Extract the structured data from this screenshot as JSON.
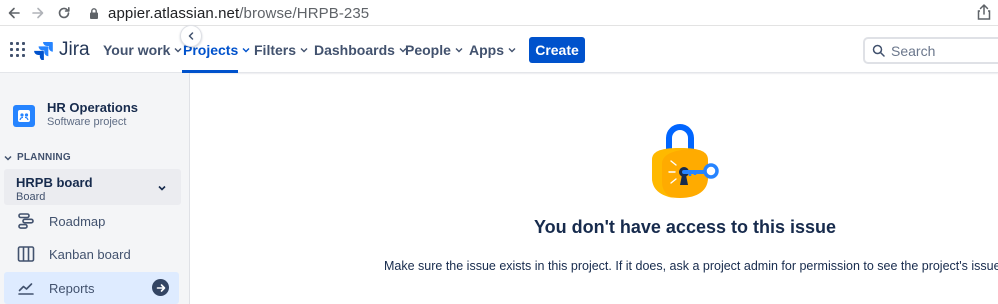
{
  "browser": {
    "url_host": "appier.atlassian.net",
    "url_path": "/browse/HRPB-235"
  },
  "topnav": {
    "logo_text": "Jira",
    "items": [
      {
        "label": "Your work"
      },
      {
        "label": "Projects"
      },
      {
        "label": "Filters"
      },
      {
        "label": "Dashboards"
      },
      {
        "label": "People"
      },
      {
        "label": "Apps"
      }
    ],
    "active_item": "Projects",
    "create_label": "Create",
    "search_placeholder": "Search"
  },
  "sidebar": {
    "project_name": "HR Operations",
    "project_type": "Software project",
    "section_label": "PLANNING",
    "board": {
      "name": "HRPB board",
      "type": "Board"
    },
    "items": [
      {
        "label": "Roadmap",
        "icon": "roadmap-icon"
      },
      {
        "label": "Kanban board",
        "icon": "kanban-board-icon"
      },
      {
        "label": "Reports",
        "icon": "reports-icon"
      }
    ],
    "selected_item": "Reports"
  },
  "main": {
    "title": "You don't have access to this issue",
    "description": "Make sure the issue exists in this project. If it does, ask a project admin for permission to see the project's issues."
  },
  "colors": {
    "primary": "#0052CC",
    "text": "#172B4D",
    "sidebar_bg": "#F4F5F7",
    "lock_body": "#FFAB00",
    "lock_shackle": "#0065FF",
    "key": "#2684FF"
  }
}
